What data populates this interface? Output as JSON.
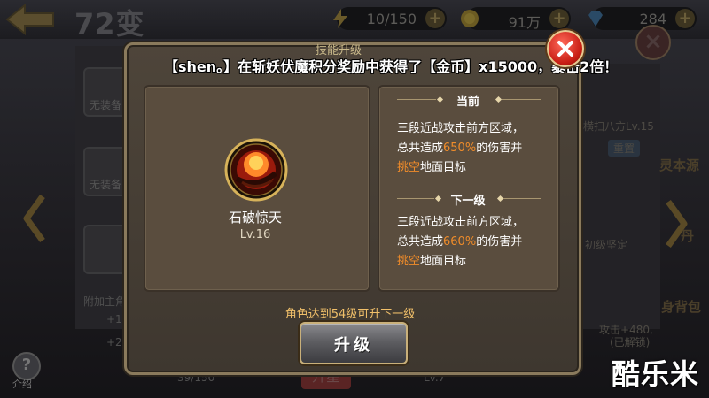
{
  "topbar": {
    "title": "72变",
    "energy": "10/150",
    "gold": "91万",
    "gems": "284"
  },
  "background": {
    "slot_label": "无装备",
    "attach_label": "附加主角",
    "stat_a": "+1",
    "stat_b": "+2",
    "progress": "39/150",
    "level": "Lv.7",
    "red_button": "升星",
    "right_skill": "横扫八方Lv.15",
    "reset": "重置",
    "right_heading_1": "灵本源",
    "right_heading_2": "丹",
    "defense": "初级坚定",
    "right_bag": "身背包",
    "right_note": "攻击+480,",
    "right_note2": "(已解锁)",
    "help_label": "介绍"
  },
  "dialog": {
    "title": "技能升级",
    "broadcast": "【shen。】在斩妖伏魔积分奖励中获得了【金币】x15000，暴击2倍！",
    "skill_name": "石破惊天",
    "skill_level": "Lv.16",
    "current_heading": "当前",
    "current_line1": "三段近战攻击前方区域，",
    "current_line2_a": "总共造成",
    "current_pct": "650%",
    "current_line2_b": "的伤害并",
    "current_line3_hl": "挑空",
    "current_line3_b": "地面目标",
    "next_heading": "下一级",
    "next_line1": "三段近战攻击前方区域，",
    "next_line2_a": "总共造成",
    "next_pct": "660%",
    "next_line2_b": "的伤害并",
    "next_line3_hl": "挑空",
    "next_line3_b": "地面目标",
    "hint": "角色达到54级可升下一级",
    "upgrade_button": "升级"
  },
  "watermark": "酷乐米",
  "colors": {
    "highlight": "#f08c2a",
    "hint": "#f1c06a",
    "close_red": "#c81e14"
  }
}
